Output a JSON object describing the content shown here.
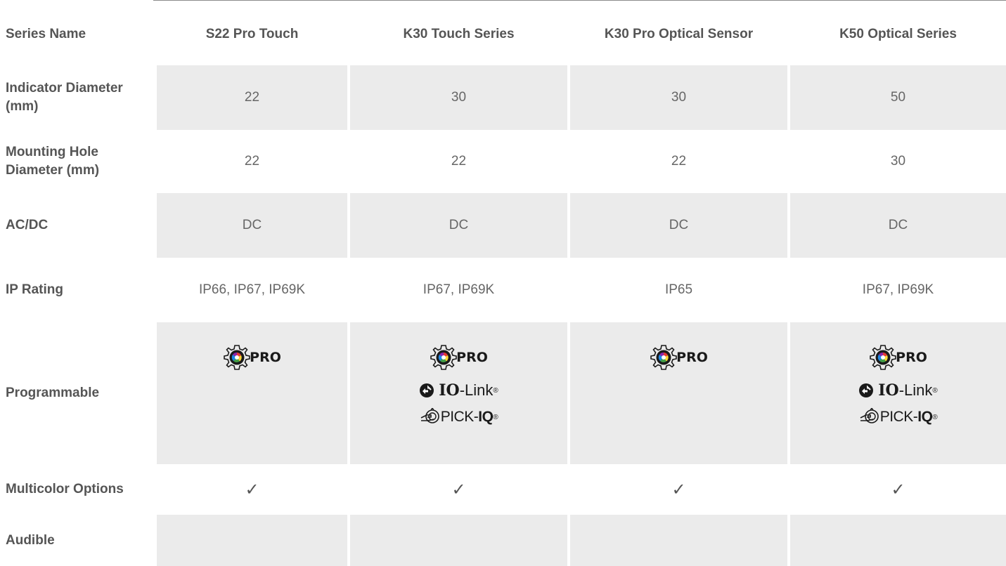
{
  "columns": [
    "S22 Pro Touch",
    "K30 Touch Series",
    "K30 Pro Optical Sensor",
    "K50 Optical Series"
  ],
  "rows": {
    "series_name": {
      "label": "Series Name"
    },
    "indicator_diameter": {
      "label": "Indicator Diameter (mm)",
      "values": [
        "22",
        "30",
        "30",
        "50"
      ]
    },
    "mounting_hole": {
      "label": "Mounting Hole Diameter (mm)",
      "values": [
        "22",
        "22",
        "22",
        "30"
      ]
    },
    "acdc": {
      "label": "AC/DC",
      "values": [
        "DC",
        "DC",
        "DC",
        "DC"
      ]
    },
    "ip_rating": {
      "label": "IP Rating",
      "values": [
        "IP66, IP67, IP69K",
        "IP67, IP69K",
        "IP65",
        "IP67, IP69K"
      ]
    },
    "programmable": {
      "label": "Programmable",
      "logos": {
        "pro": "PRO",
        "iolink_io": "IO",
        "iolink_link": "-Link",
        "reg": "®",
        "pick": "PICK-",
        "iq": "IQ"
      },
      "cells": [
        [
          "pro"
        ],
        [
          "pro",
          "iolink",
          "pickiq"
        ],
        [
          "pro"
        ],
        [
          "pro",
          "iolink",
          "pickiq"
        ]
      ]
    },
    "multicolor": {
      "label": "Multicolor Options",
      "values": [
        "✓",
        "✓",
        "✓",
        "✓"
      ]
    },
    "audible": {
      "label": "Audible",
      "values": [
        "",
        "",
        "",
        ""
      ]
    }
  },
  "colors": {
    "shade": "#ebebeb",
    "text": "#555555"
  },
  "icons": {
    "pro": "gear-color-wheel-icon",
    "iolink": "io-link-icon",
    "pickiq": "pick-iq-hand-icon",
    "check": "checkmark-icon"
  }
}
